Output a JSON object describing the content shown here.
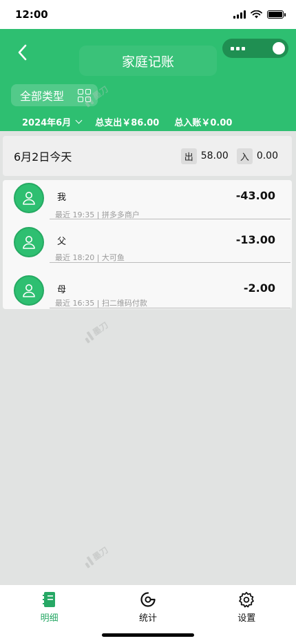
{
  "status_bar": {
    "time": "12:00"
  },
  "header": {
    "title": "家庭记账",
    "type_filter": "全部类型",
    "month": "2024年6月",
    "total_out": "总支出￥86.00",
    "total_in": "总入账￥0.00"
  },
  "day": {
    "label": "6月2日今天",
    "out_tag": "出",
    "out_value": "58.00",
    "in_tag": "入",
    "in_value": "0.00"
  },
  "entries": [
    {
      "name": "我",
      "sub": "最近 19:35 | 拼多多商户",
      "amount": "-43.00"
    },
    {
      "name": "父",
      "sub": "最近 18:20 | 大可鱼",
      "amount": "-13.00"
    },
    {
      "name": "母",
      "sub": "最近 16:35 | 扫二维码付款",
      "amount": "-2.00"
    }
  ],
  "watermark": {
    "text": "墨刀"
  },
  "tabs": [
    {
      "label": "明细",
      "icon": "notebook-icon",
      "active": true
    },
    {
      "label": "统计",
      "icon": "chart-donut-icon",
      "active": false
    },
    {
      "label": "设置",
      "icon": "gear-icon",
      "active": false
    }
  ],
  "colors": {
    "primary": "#2ebf71",
    "active_tab": "#27a865",
    "background": "#e1e3e2"
  }
}
